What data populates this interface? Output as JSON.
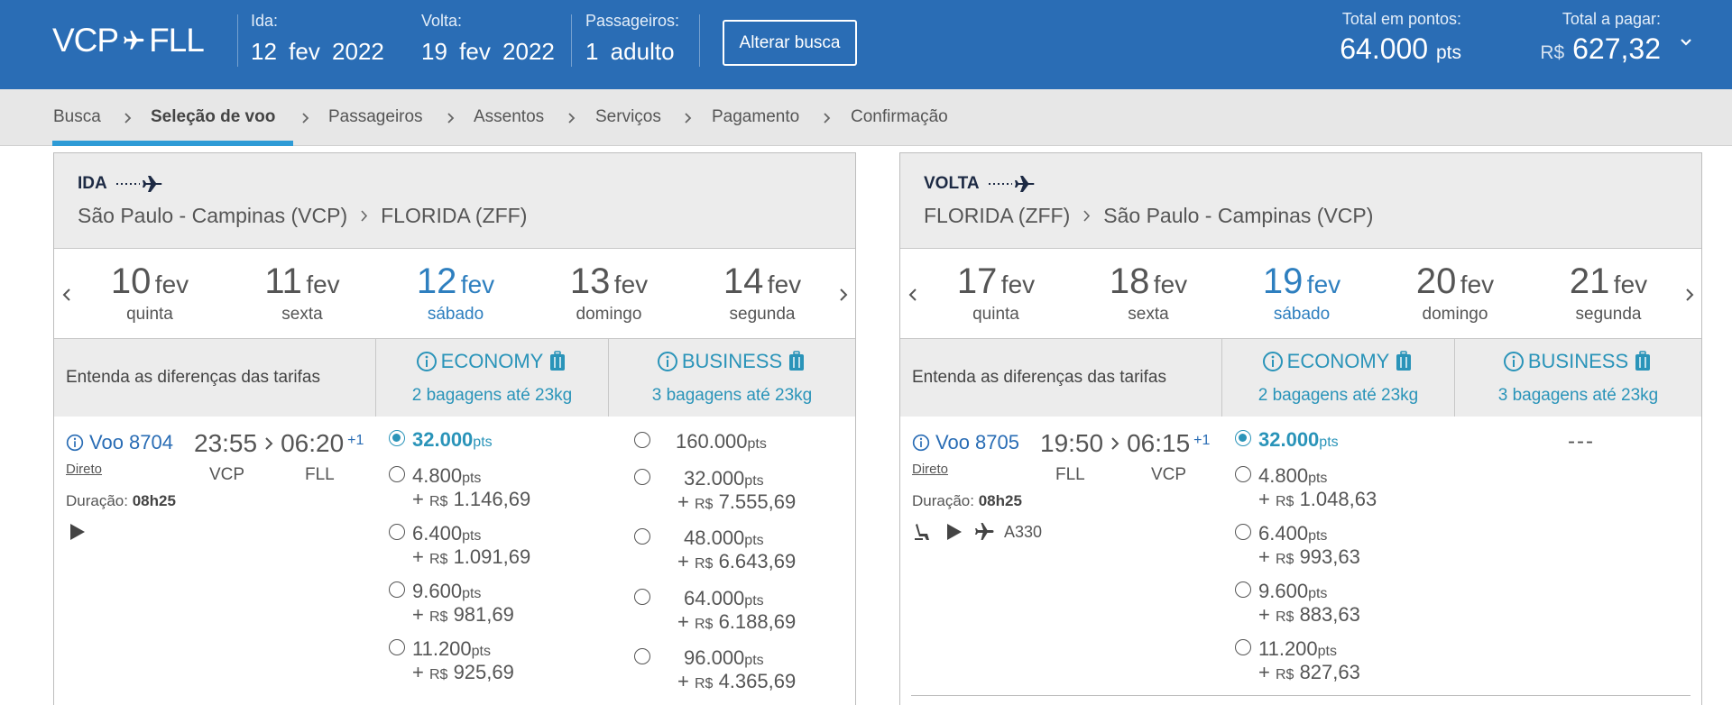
{
  "header": {
    "route_from": "VCP",
    "route_to": "FLL",
    "ida_label": "Ida:",
    "ida_value": "12 fev 2022",
    "volta_label": "Volta:",
    "volta_value": "19 fev 2022",
    "pax_label": "Passageiros:",
    "pax_value": "1 adulto",
    "alter_button": "Alterar busca",
    "total_points_label": "Total em pontos:",
    "total_points_value": "64.000",
    "total_points_unit": "pts",
    "total_pay_label": "Total a pagar:",
    "total_pay_currency": "R$",
    "total_pay_value": "627,32"
  },
  "breadcrumb": [
    "Busca",
    "Seleção de voo",
    "Passageiros",
    "Assentos",
    "Serviços",
    "Pagamento",
    "Confirmação"
  ],
  "common": {
    "diff_label": "Entenda as diferenças das tarifas",
    "economy": "ECONOMY",
    "business": "BUSINESS",
    "economy_bags": "2 bagagens até 23kg",
    "business_bags": "3 bagagens até 23kg",
    "pts_unit": "pts",
    "currency": "R$",
    "plus": "+",
    "direct": "Direto",
    "duration_label": "Duração:",
    "month": "fev"
  },
  "ida": {
    "leg": "IDA",
    "origin": "São Paulo - Campinas (VCP)",
    "destination": "FLORIDA (ZFF)",
    "dates": [
      {
        "day": "10",
        "weekday": "quinta"
      },
      {
        "day": "11",
        "weekday": "sexta"
      },
      {
        "day": "12",
        "weekday": "sábado"
      },
      {
        "day": "13",
        "weekday": "domingo"
      },
      {
        "day": "14",
        "weekday": "segunda"
      }
    ],
    "flight": {
      "number": "Voo 8704",
      "dep": "23:55",
      "arr": "06:20",
      "plus_day": "+1",
      "from": "VCP",
      "to": "FLL",
      "duration": "08h25"
    },
    "economy_options": [
      {
        "pts": "32.000",
        "cash": ""
      },
      {
        "pts": "4.800",
        "cash": "1.146,69"
      },
      {
        "pts": "6.400",
        "cash": "1.091,69"
      },
      {
        "pts": "9.600",
        "cash": "981,69"
      },
      {
        "pts": "11.200",
        "cash": "925,69"
      }
    ],
    "business_options": [
      {
        "pts": "160.000",
        "cash": ""
      },
      {
        "pts": "32.000",
        "cash": "7.555,69"
      },
      {
        "pts": "48.000",
        "cash": "6.643,69"
      },
      {
        "pts": "64.000",
        "cash": "6.188,69"
      },
      {
        "pts": "96.000",
        "cash": "4.365,69"
      }
    ]
  },
  "volta": {
    "leg": "VOLTA",
    "origin": "FLORIDA (ZFF)",
    "destination": "São Paulo - Campinas (VCP)",
    "dates": [
      {
        "day": "17",
        "weekday": "quinta"
      },
      {
        "day": "18",
        "weekday": "sexta"
      },
      {
        "day": "19",
        "weekday": "sábado"
      },
      {
        "day": "20",
        "weekday": "domingo"
      },
      {
        "day": "21",
        "weekday": "segunda"
      }
    ],
    "flight": {
      "number": "Voo 8705",
      "dep": "19:50",
      "arr": "06:15",
      "plus_day": "+1",
      "from": "FLL",
      "to": "VCP",
      "duration": "08h25",
      "aircraft": "A330"
    },
    "economy_options": [
      {
        "pts": "32.000",
        "cash": ""
      },
      {
        "pts": "4.800",
        "cash": "1.048,63"
      },
      {
        "pts": "6.400",
        "cash": "993,63"
      },
      {
        "pts": "9.600",
        "cash": "883,63"
      },
      {
        "pts": "11.200",
        "cash": "827,63"
      }
    ],
    "business_unavailable": "---"
  }
}
